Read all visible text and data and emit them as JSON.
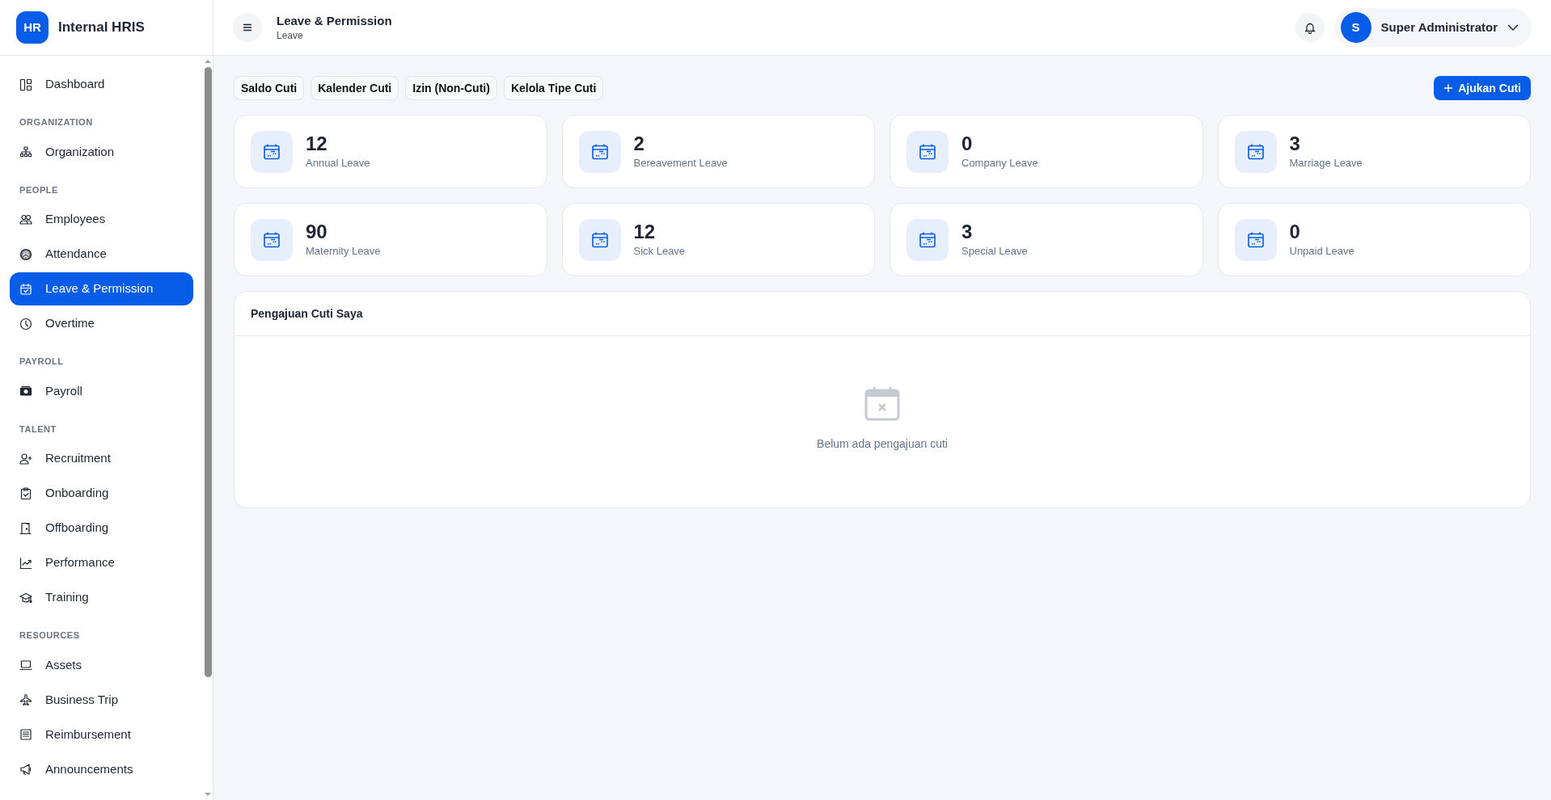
{
  "app": {
    "logo": "HR",
    "name": "Internal HRIS"
  },
  "sidebar": {
    "sections": [
      {
        "items": [
          {
            "label": "Dashboard",
            "selected": false
          }
        ]
      },
      {
        "title": "ORGANIZATION",
        "items": [
          {
            "label": "Organization",
            "selected": false
          }
        ]
      },
      {
        "title": "PEOPLE",
        "items": [
          {
            "label": "Employees",
            "selected": false
          },
          {
            "label": "Attendance",
            "selected": false
          },
          {
            "label": "Leave & Permission",
            "selected": true
          },
          {
            "label": "Overtime",
            "selected": false
          }
        ]
      },
      {
        "title": "PAYROLL",
        "items": [
          {
            "label": "Payroll",
            "selected": false
          }
        ]
      },
      {
        "title": "TALENT",
        "items": [
          {
            "label": "Recruitment",
            "selected": false
          },
          {
            "label": "Onboarding",
            "selected": false
          },
          {
            "label": "Offboarding",
            "selected": false
          },
          {
            "label": "Performance",
            "selected": false
          },
          {
            "label": "Training",
            "selected": false
          }
        ]
      },
      {
        "title": "RESOURCES",
        "items": [
          {
            "label": "Assets",
            "selected": false
          },
          {
            "label": "Business Trip",
            "selected": false
          },
          {
            "label": "Reimbursement",
            "selected": false
          },
          {
            "label": "Announcements",
            "selected": false
          }
        ]
      }
    ]
  },
  "header": {
    "title": "Leave & Permission",
    "subtitle": "Leave",
    "user": {
      "initial": "S",
      "name": "Super Administrator"
    }
  },
  "tabs": [
    {
      "label": "Saldo Cuti"
    },
    {
      "label": "Kalender Cuti"
    },
    {
      "label": "Izin (Non-Cuti)"
    },
    {
      "label": "Kelola Tipe Cuti"
    }
  ],
  "primary_button": "Ajukan Cuti",
  "balances": [
    {
      "value": "12",
      "label": "Annual Leave"
    },
    {
      "value": "2",
      "label": "Bereavement Leave"
    },
    {
      "value": "0",
      "label": "Company Leave"
    },
    {
      "value": "3",
      "label": "Marriage Leave"
    },
    {
      "value": "90",
      "label": "Maternity Leave"
    },
    {
      "value": "12",
      "label": "Sick Leave"
    },
    {
      "value": "3",
      "label": "Special Leave"
    },
    {
      "value": "0",
      "label": "Unpaid Leave"
    }
  ],
  "requests_panel": {
    "title": "Pengajuan Cuti Saya",
    "empty_message": "Belum ada pengajuan cuti"
  }
}
